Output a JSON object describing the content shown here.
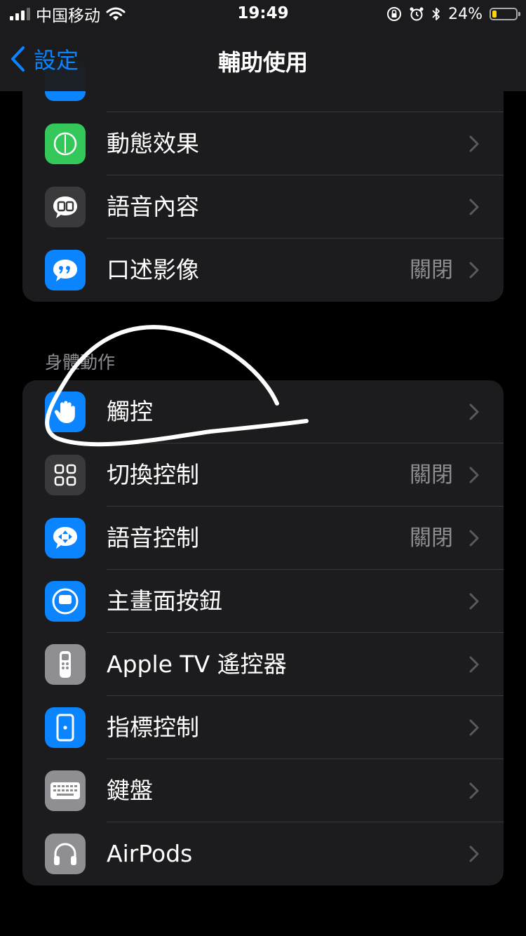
{
  "status_bar": {
    "carrier": "中国移动",
    "time": "19:49",
    "battery_percent": "24%",
    "battery_level": 0.24
  },
  "nav": {
    "back_label": "設定",
    "title": "輔助使用"
  },
  "vision_group": {
    "rows": [
      {
        "label": "動態效果",
        "value": "",
        "icon": "motion-icon",
        "icon_color": "#34c759"
      },
      {
        "label": "語音內容",
        "value": "",
        "icon": "spoken-content-icon",
        "icon_color": "#3a3a3c"
      },
      {
        "label": "口述影像",
        "value": "關閉",
        "icon": "audio-descriptions-icon",
        "icon_color": "#0a84ff"
      }
    ]
  },
  "physical_section": {
    "header": "身體動作",
    "rows": [
      {
        "label": "觸控",
        "value": "",
        "icon": "touch-icon",
        "icon_color": "#0a84ff"
      },
      {
        "label": "切換控制",
        "value": "關閉",
        "icon": "switch-control-icon",
        "icon_color": "#3a3a3c"
      },
      {
        "label": "語音控制",
        "value": "關閉",
        "icon": "voice-control-icon",
        "icon_color": "#0a84ff"
      },
      {
        "label": "主畫面按鈕",
        "value": "",
        "icon": "home-button-icon",
        "icon_color": "#0a84ff"
      },
      {
        "label": "Apple TV 遙控器",
        "value": "",
        "icon": "apple-tv-remote-icon",
        "icon_color": "#8e8e93"
      },
      {
        "label": "指標控制",
        "value": "",
        "icon": "pointer-control-icon",
        "icon_color": "#0a84ff"
      },
      {
        "label": "鍵盤",
        "value": "",
        "icon": "keyboard-icon",
        "icon_color": "#8e8e93"
      },
      {
        "label": "AirPods",
        "value": "",
        "icon": "airpods-icon",
        "icon_color": "#8e8e93"
      }
    ]
  }
}
